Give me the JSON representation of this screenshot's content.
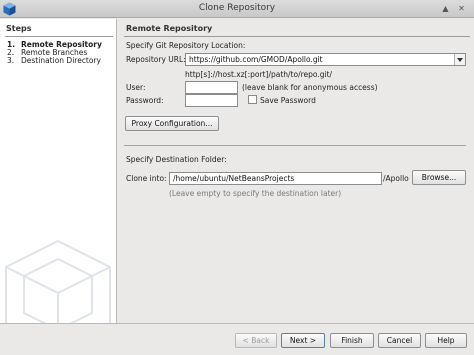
{
  "window": {
    "title": "Clone Repository"
  },
  "steps": {
    "header": "Steps",
    "items": [
      {
        "num": "1.",
        "label": "Remote Repository"
      },
      {
        "num": "2.",
        "label": "Remote Branches"
      },
      {
        "num": "3.",
        "label": "Destination Directory"
      }
    ]
  },
  "remote": {
    "header": "Remote Repository",
    "section_label": "Specify Git Repository Location:",
    "url_label": "Repository URL:",
    "url_value": "https://github.com/GMOD/Apollo.git",
    "url_hint": "http[s]://host.xz[:port]/path/to/repo.git/",
    "user_label": "User:",
    "user_value": "",
    "user_hint": "(leave blank for anonymous access)",
    "password_label": "Password:",
    "password_value": "",
    "save_password_label": "Save Password",
    "proxy_button": "Proxy Configuration..."
  },
  "destination": {
    "section_label": "Specify Destination Folder:",
    "clone_label": "Clone into:",
    "clone_value": "/home/ubuntu/NetBeansProjects",
    "clone_suffix": "/Apollo",
    "browse_button": "Browse...",
    "hint": "(Leave empty to specify the destination later)"
  },
  "footer": {
    "back": "< Back",
    "next": "Next >",
    "finish": "Finish",
    "cancel": "Cancel",
    "help": "Help"
  }
}
